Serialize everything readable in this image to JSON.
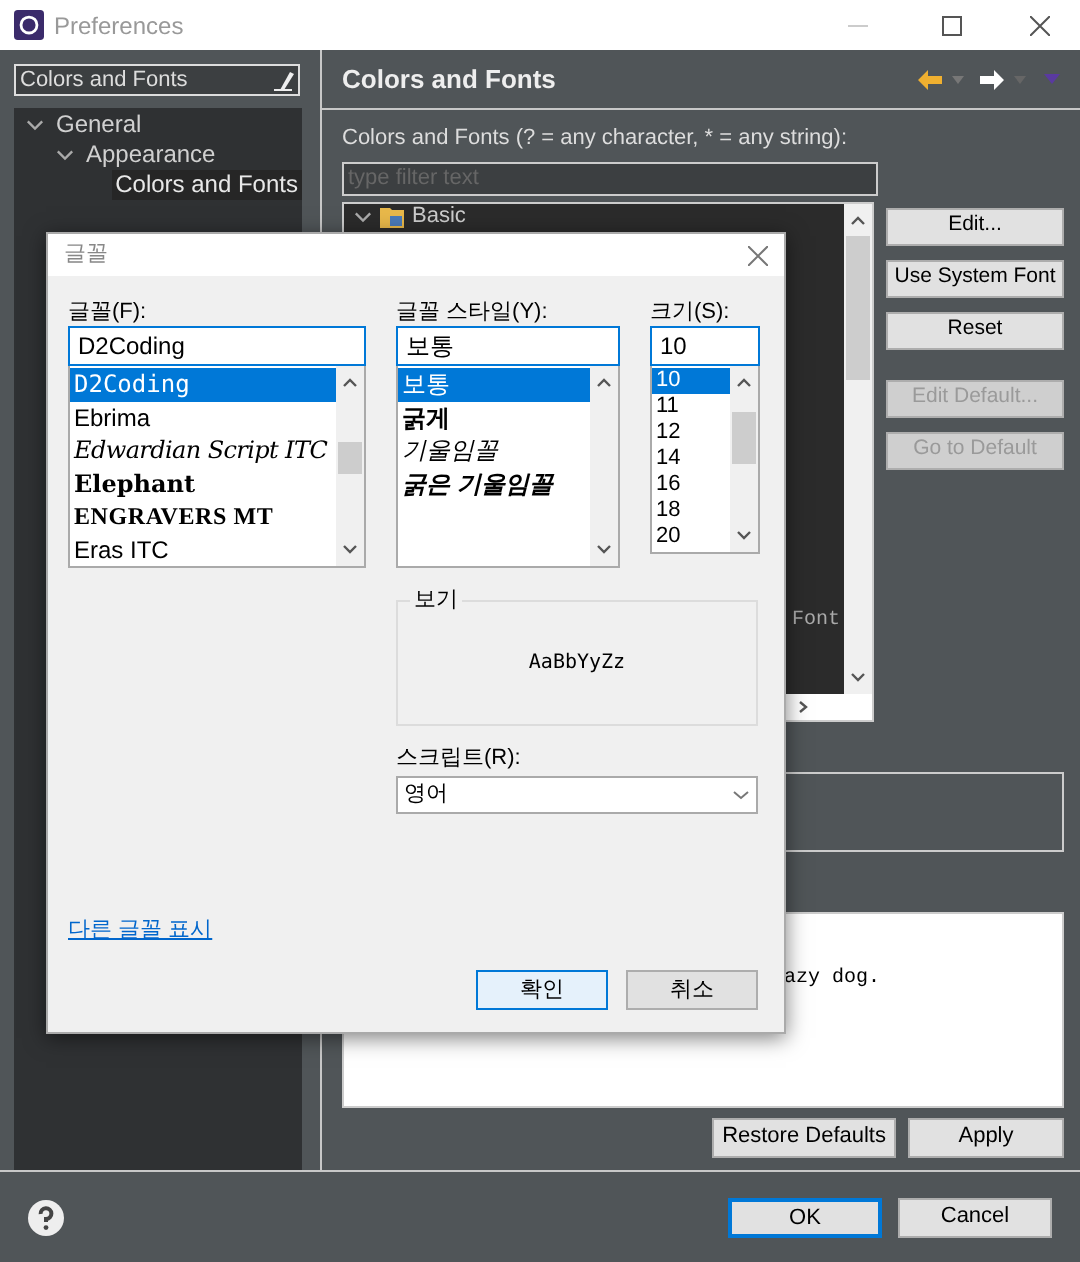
{
  "window": {
    "title": "Preferences"
  },
  "sidebar": {
    "filter_value": "Colors and Fonts",
    "tree": [
      {
        "label": "General",
        "expanded": true,
        "selected": false,
        "children": [
          {
            "label": "Appearance",
            "expanded": true,
            "selected": false,
            "children": [
              {
                "label": "Colors and Fonts",
                "selected": true
              }
            ]
          }
        ]
      }
    ]
  },
  "page": {
    "title": "Colors and Fonts",
    "filter_label": "Colors and Fonts (? = any character, * = any string):",
    "filter_placeholder": "type filter text",
    "tree": [
      {
        "label": "Basic",
        "expanded": true
      }
    ],
    "tree_fragment": "Font",
    "side_buttons": [
      {
        "label": "Edit...",
        "disabled": false
      },
      {
        "label": "Use System Font",
        "disabled": false
      },
      {
        "label": "Reset",
        "disabled": false
      },
      {
        "label": "Edit Default...",
        "disabled": true
      },
      {
        "label": "Go to Default",
        "disabled": true
      }
    ],
    "preview_text": "azy dog.",
    "buttons": [
      {
        "label": "Restore Defaults"
      },
      {
        "label": "Apply"
      }
    ]
  },
  "footer": {
    "buttons": [
      {
        "label": "OK",
        "default": true
      },
      {
        "label": "Cancel",
        "default": false
      }
    ]
  },
  "font_dialog": {
    "title": "글꼴",
    "font": {
      "label": "글꼴(F):",
      "value": "D2Coding",
      "items": [
        {
          "label": "D2Coding",
          "kind": "mono",
          "selected": true
        },
        {
          "label": "Ebrima",
          "kind": "plain",
          "selected": false
        },
        {
          "label": "Edwardian Script ITC",
          "kind": "script",
          "selected": false
        },
        {
          "label": "Elephant",
          "kind": "heavy",
          "selected": false
        },
        {
          "label": "ENGRAVERS MT",
          "kind": "engraved",
          "selected": false
        },
        {
          "label": "Eras ITC",
          "kind": "plain",
          "selected": false
        }
      ]
    },
    "style": {
      "label": "글꼴 스타일(Y):",
      "value": "보통",
      "items": [
        {
          "label": "보통",
          "kind": "regular",
          "selected": true
        },
        {
          "label": "굵게",
          "kind": "bold",
          "selected": false
        },
        {
          "label": "기울임꼴",
          "kind": "italic",
          "selected": false
        },
        {
          "label": "굵은 기울임꼴",
          "kind": "bold-italic",
          "selected": false
        }
      ]
    },
    "size": {
      "label": "크기(S):",
      "value": "10",
      "items": [
        {
          "label": "10",
          "selected": true
        },
        {
          "label": "11",
          "selected": false
        },
        {
          "label": "12",
          "selected": false
        },
        {
          "label": "14",
          "selected": false
        },
        {
          "label": "16",
          "selected": false
        },
        {
          "label": "18",
          "selected": false
        },
        {
          "label": "20",
          "selected": false
        }
      ]
    },
    "preview": {
      "label": "보기",
      "sample": "AaBbYyZz"
    },
    "script": {
      "label": "스크립트(R):",
      "value": "영어"
    },
    "link": "다른 글꼴 표시",
    "buttons": [
      {
        "label": "확인",
        "default": true
      },
      {
        "label": "취소",
        "default": false
      }
    ]
  }
}
